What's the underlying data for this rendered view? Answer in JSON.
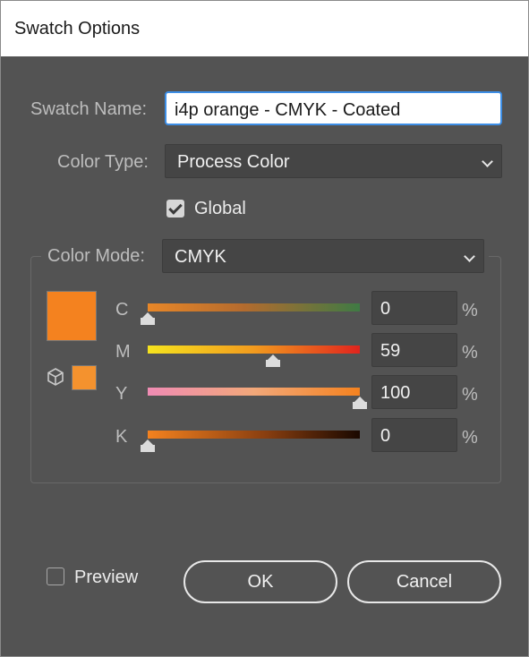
{
  "window": {
    "title": "Swatch Options"
  },
  "form": {
    "swatch_name_label": "Swatch Name:",
    "swatch_name_value": "i4p orange - CMYK - Coated",
    "color_type_label": "Color Type:",
    "color_type_value": "Process Color",
    "global_label": "Global",
    "global_checked": true,
    "color_mode_label": "Color Mode:",
    "color_mode_value": "CMYK"
  },
  "swatch": {
    "color": "#f4821f",
    "out_of_gamut_color": "#f4922e",
    "icon": "cube-icon"
  },
  "channels": [
    {
      "label": "C",
      "value": "0",
      "unit": "%"
    },
    {
      "label": "M",
      "value": "59",
      "unit": "%"
    },
    {
      "label": "Y",
      "value": "100",
      "unit": "%"
    },
    {
      "label": "K",
      "value": "0",
      "unit": "%"
    }
  ],
  "footer": {
    "preview_label": "Preview",
    "preview_checked": false,
    "ok_label": "OK",
    "cancel_label": "Cancel"
  }
}
